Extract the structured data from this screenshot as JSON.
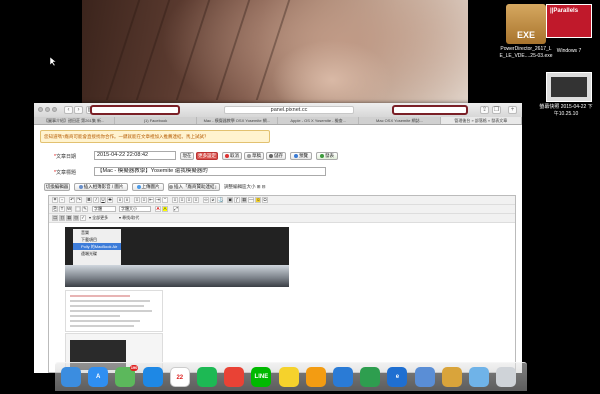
{
  "desktop": {
    "exe_label": "EXE",
    "exe_caption": "PowerDirector_2617_L\nE_LE_VDE....25-03.exe",
    "parallels_label": "||Parallels",
    "parallels_caption": "Windows 7",
    "screenshot_caption": "螢幕快照 2015-04-22 下\n午10.25.10"
  },
  "browser": {
    "address": "panel.pixnet.cc",
    "tabs": [
      "【圖事介紹】甜田莊 第261集 新...",
      "(1) Facebook",
      "Mac - 模擬器教學 OSX Yosemite 網...",
      "Apple - OS X Yosemite - 檢查...",
      "Mac OSX Yosemite 網誌...",
      "管理後台 » 部落格 » 發表文章"
    ]
  },
  "form": {
    "notice": "您知道嗎?廠商可能會直接找你合作。一鍵就能在文章裡加入推薦連結。馬上試試？",
    "date_label": "文章日期",
    "date_value": "2015-04-22 22:08:42",
    "now_button": "現在",
    "more_button": "更多設定",
    "cancel_button": "取消",
    "draft_button": "草稿",
    "save_button": "儲存",
    "preview_button": "預覽",
    "publish_button": "發表",
    "title_label": "文章標題",
    "title_value": "【Mac - 模擬器教學】Yosemite 還我模擬器的",
    "toolbar": {
      "switch_editor": "切換編輯器",
      "insert_media": "插入相簿影音 / 圖片",
      "upload_image": "上傳圖片",
      "insert_ad": "插入「廠商贊助連結」",
      "resize": "調整編輯區大小"
    },
    "font_select": "字體",
    "size_select": "字體大小",
    "all_button": "全部更多",
    "find_button": "尋找/取代"
  },
  "menu_items": [
    "音樂",
    "下載項目",
    "Polly 的MacBook Air",
    "遠端光碟"
  ],
  "dock_apps": [
    {
      "name": "finder-icon",
      "label": "",
      "color": "#3b8de0"
    },
    {
      "name": "app-store-icon",
      "label": "A",
      "color": "#2f8ff2"
    },
    {
      "name": "messages-icon",
      "label": "",
      "color": "#5cb85c",
      "badge": "190"
    },
    {
      "name": "safari-icon",
      "label": "",
      "color": "#1e88e5"
    },
    {
      "name": "calendar-icon",
      "label": "22",
      "color": "#ffffff"
    },
    {
      "name": "spotify-icon",
      "label": "",
      "color": "#1db954"
    },
    {
      "name": "chrome-icon",
      "label": "",
      "color": "#e94235"
    },
    {
      "name": "line-icon",
      "label": "LINE",
      "color": "#00b900"
    },
    {
      "name": "minions-icon",
      "label": "",
      "color": "#f5d22c"
    },
    {
      "name": "photos-icon",
      "label": "",
      "color": "#f39c12"
    },
    {
      "name": "windows-icon",
      "label": "",
      "color": "#2a7bd6"
    },
    {
      "name": "numbers-icon",
      "label": "",
      "color": "#2e9e4f"
    },
    {
      "name": "ie-icon",
      "label": "e",
      "color": "#1f6fd1"
    },
    {
      "name": "app-icon",
      "label": "",
      "color": "#5a8ed6"
    },
    {
      "name": "game-character-icon",
      "label": "",
      "color": "#d9a43b"
    },
    {
      "name": "folder-icon",
      "label": "",
      "color": "#6fb3e8"
    },
    {
      "name": "trash-icon",
      "label": "",
      "color": "#cfd3d8"
    }
  ]
}
